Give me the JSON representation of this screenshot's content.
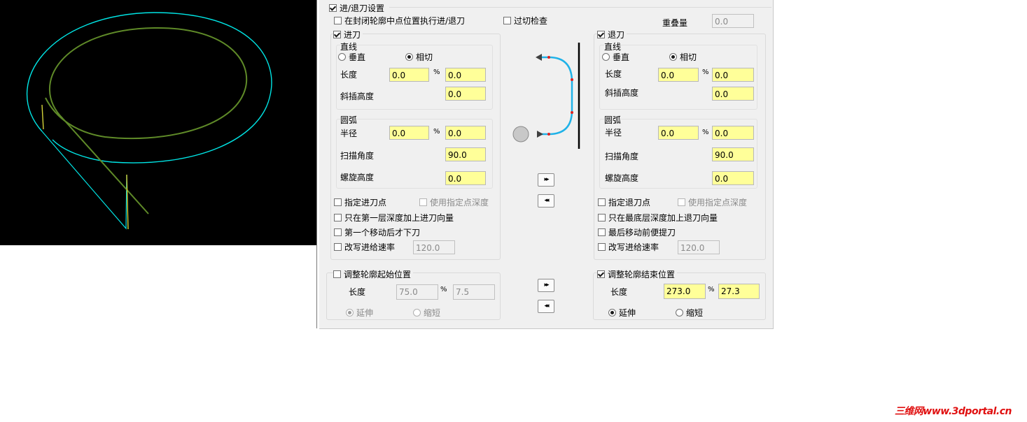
{
  "colors": {
    "viewport_bg": "#000000",
    "outer_contour": "#00e5e5",
    "inner_contour": "#5f8a28",
    "lead_line": "#d4d43a",
    "field_highlight": "#ffff99",
    "preview_arc": "#1fb2e8",
    "watermark": "#e01010"
  },
  "header": {
    "title": "进/退刀设置",
    "checked": true
  },
  "top": {
    "closed_midpoint": {
      "label": "在封闭轮廓中点位置执行进/退刀",
      "checked": false
    },
    "gouge_check": {
      "label": "过切检查",
      "checked": false
    },
    "overlap": {
      "label": "重叠量",
      "value": "0.0"
    }
  },
  "entry": {
    "title": "进刀",
    "checked": true,
    "line": {
      "title": "直线",
      "perpendicular": "垂直",
      "tangent": "相切",
      "selected": "相切",
      "length_label": "长度",
      "length": "0.0",
      "percent_sign": "%",
      "length_pct": "0.0",
      "ramp_label": "斜插高度",
      "ramp": "0.0"
    },
    "arc": {
      "title": "圆弧",
      "radius_label": "半径",
      "radius": "0.0",
      "percent_sign": "%",
      "radius_pct": "0.0",
      "sweep_label": "扫描角度",
      "sweep": "90.0",
      "helix_label": "螺旋高度",
      "helix": "0.0"
    },
    "opt_point": {
      "label": "指定进刀点",
      "checked": false
    },
    "opt_point_depth": {
      "label": "使用指定点深度",
      "checked": false
    },
    "opt_first_depth": {
      "label": "只在第一层深度加上进刀向量",
      "checked": false
    },
    "opt_after_move": {
      "label": "第一个移动后才下刀",
      "checked": false
    },
    "opt_feed": {
      "label": "改写进给速率",
      "checked": false,
      "value": "120.0"
    }
  },
  "exit": {
    "title": "退刀",
    "checked": true,
    "line": {
      "title": "直线",
      "perpendicular": "垂直",
      "tangent": "相切",
      "selected": "相切",
      "length_label": "长度",
      "length": "0.0",
      "percent_sign": "%",
      "length_pct": "0.0",
      "ramp_label": "斜插高度",
      "ramp": "0.0"
    },
    "arc": {
      "title": "圆弧",
      "radius_label": "半径",
      "radius": "0.0",
      "percent_sign": "%",
      "radius_pct": "0.0",
      "sweep_label": "扫描角度",
      "sweep": "90.0",
      "helix_label": "螺旋高度",
      "helix": "0.0"
    },
    "opt_point": {
      "label": "指定退刀点",
      "checked": false
    },
    "opt_point_depth": {
      "label": "使用指定点深度",
      "checked": false
    },
    "opt_last_depth": {
      "label": "只在最底层深度加上退刀向量",
      "checked": false
    },
    "opt_before_move": {
      "label": "最后移动前便提刀",
      "checked": false
    },
    "opt_feed": {
      "label": "改写进给速率",
      "checked": false,
      "value": "120.0"
    }
  },
  "adjust_start": {
    "title": "调整轮廓起始位置",
    "checked": false,
    "length_label": "长度",
    "length": "75.0",
    "percent_sign": "%",
    "length_pct": "7.5",
    "extend": "延伸",
    "shorten": "缩短",
    "selected": "延伸"
  },
  "adjust_end": {
    "title": "调整轮廓结束位置",
    "checked": true,
    "length_label": "长度",
    "length": "273.0",
    "percent_sign": "%",
    "length_pct": "27.3",
    "extend": "延伸",
    "shorten": "缩短",
    "selected": "延伸"
  },
  "copy_buttons": {
    "to_right": "▸▸",
    "to_left": "◂◂"
  },
  "watermark": "三维网www.3dportal.cn"
}
